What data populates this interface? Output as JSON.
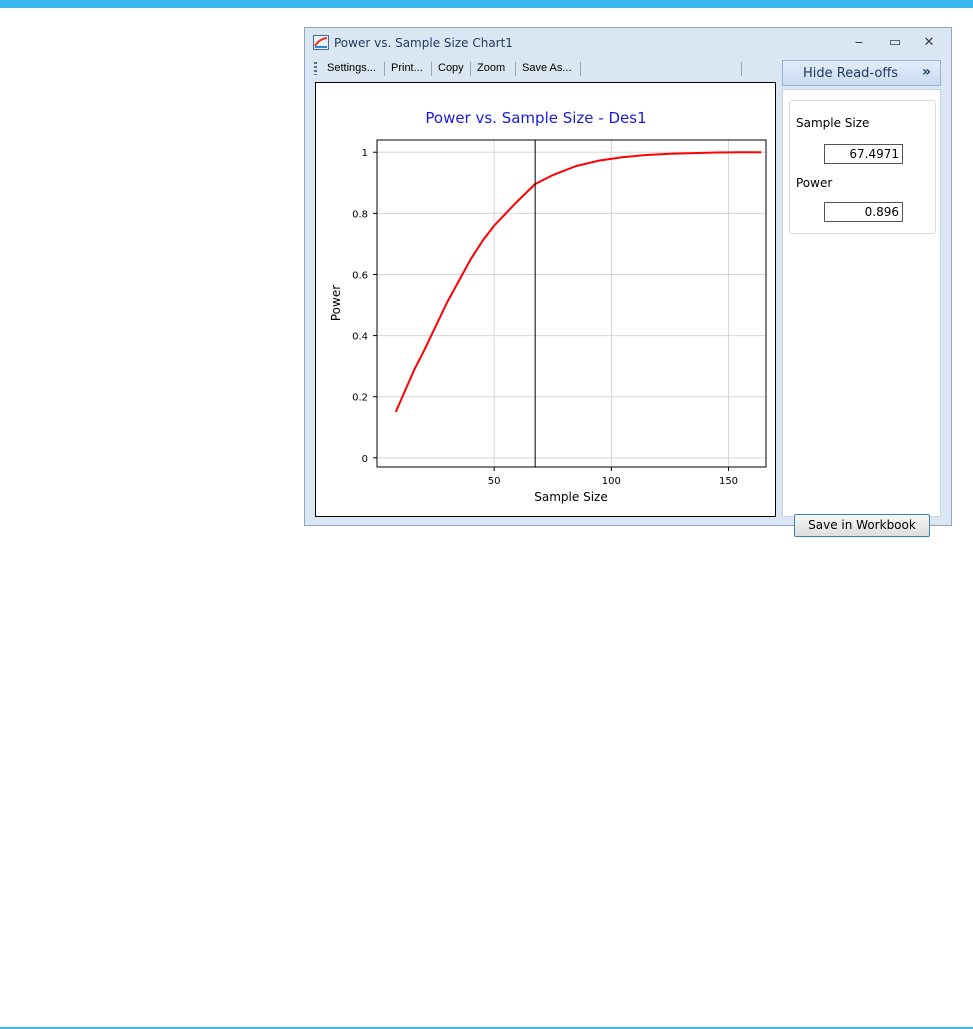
{
  "window": {
    "title": "Power vs. Sample Size Chart1",
    "minimize_glyph": "‒",
    "maximize_glyph": "▭",
    "close_glyph": "✕"
  },
  "toolbar": {
    "settings_label": "Settings...",
    "print_label": "Print...",
    "copy_label": "Copy",
    "zoom_label": "Zoom",
    "saveas_label": "Save As..."
  },
  "readoffs": {
    "toggle_label": "Hide Read-offs",
    "toggle_chevron": "»",
    "sample_size_label": "Sample Size",
    "sample_size_value": "67.4971",
    "power_label": "Power",
    "power_value": "0.896",
    "save_label": "Save in Workbook"
  },
  "colors": {
    "accent": "#3bb7ee",
    "title": "#1a1adb",
    "curve": "#ff0000"
  },
  "chart_data": {
    "type": "line",
    "title": "Power vs. Sample Size - Des1",
    "xlabel": "Sample Size",
    "ylabel": "Power",
    "xlim": [
      0,
      166
    ],
    "ylim": [
      -0.03,
      1.04
    ],
    "xticks": [
      50,
      100,
      150
    ],
    "yticks": [
      0,
      0.2,
      0.4,
      0.6,
      0.8,
      1
    ],
    "grid": true,
    "legend": "none",
    "marker_x": 67.4971,
    "series": [
      {
        "x": [
          8,
          12,
          16,
          20,
          25,
          30,
          35,
          40,
          45,
          50,
          55,
          60,
          67.5,
          75,
          85,
          95,
          105,
          115,
          125,
          135,
          145,
          155,
          164
        ],
        "y": [
          0.15,
          0.22,
          0.29,
          0.35,
          0.43,
          0.51,
          0.58,
          0.65,
          0.71,
          0.76,
          0.8,
          0.84,
          0.896,
          0.925,
          0.955,
          0.973,
          0.984,
          0.991,
          0.995,
          0.997,
          0.999,
          1.0,
          1.0
        ]
      }
    ]
  }
}
